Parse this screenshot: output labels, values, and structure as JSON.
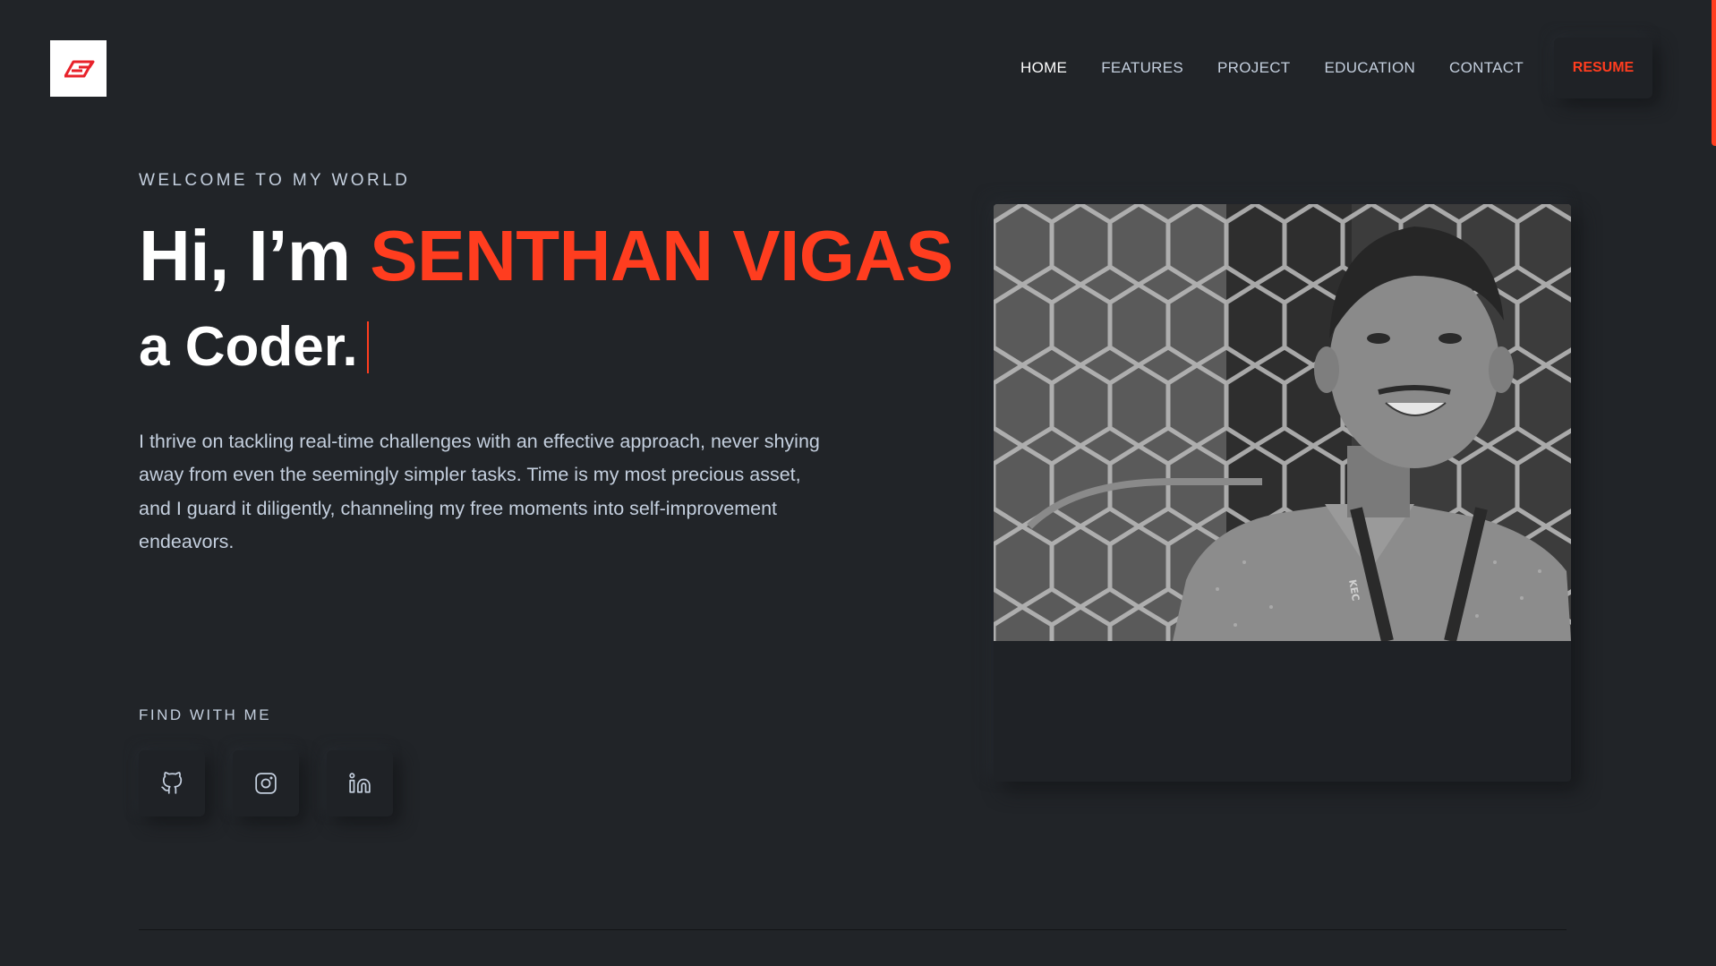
{
  "header": {
    "logo_mark": "SV",
    "nav": {
      "home": "HOME",
      "features": "FEATURES",
      "project": "PROJECT",
      "education": "EDUCATION",
      "contact": "CONTACT"
    },
    "resume_label": "RESUME"
  },
  "hero": {
    "subtitle": "WELCOME TO MY WORLD",
    "greeting": "Hi, I’m",
    "name": "SENTHAN VIGAS",
    "typed_text": "a Coder.",
    "description": "I thrive on tackling real-time challenges with an effective approach, never shying away from even the seemingly simpler tasks. Time is my most precious asset, and I guard it diligently, channeling my free moments into self-improvement endeavors.",
    "find_title": "FIND WITH ME",
    "socials": [
      "github-icon",
      "instagram-icon",
      "linkedin-icon"
    ],
    "photo_lanyard_text": "KEC"
  },
  "colors": {
    "background": "#212428",
    "accent": "#ff3d1f",
    "text": "#c4cfde",
    "heading": "#ffffff"
  }
}
